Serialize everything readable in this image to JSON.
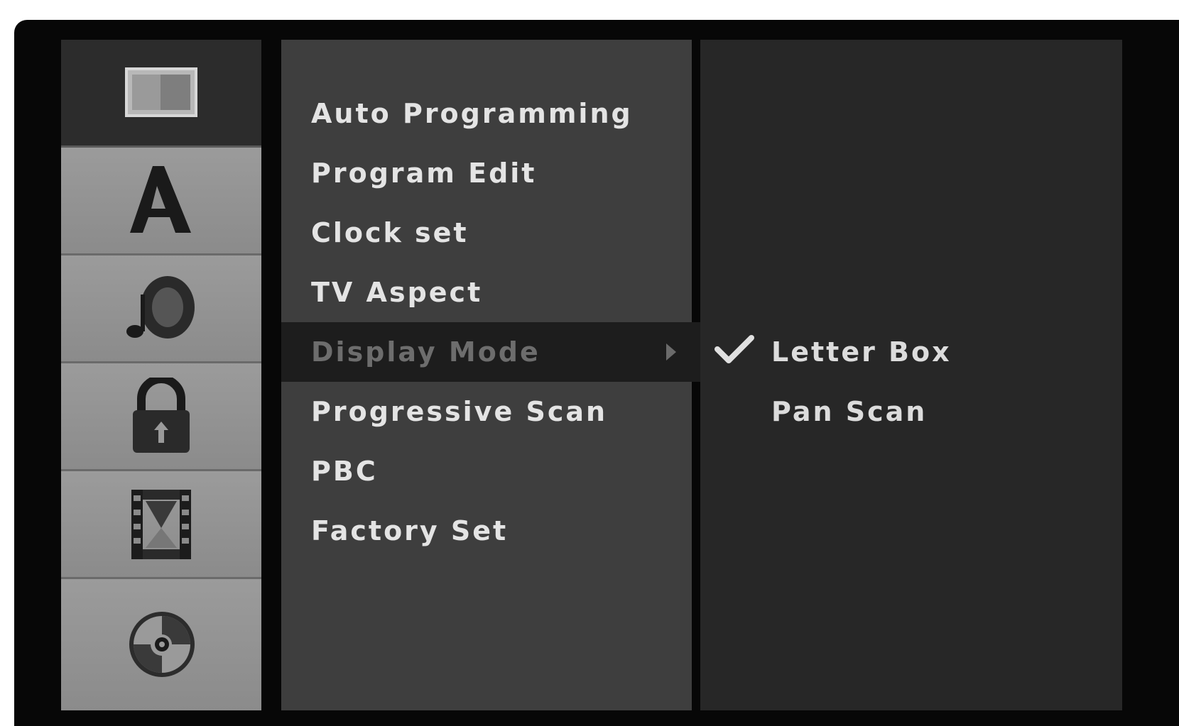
{
  "sidebar": {
    "icons": [
      {
        "name": "tv-icon",
        "active": true
      },
      {
        "name": "language-icon",
        "active": false
      },
      {
        "name": "audio-icon",
        "active": false
      },
      {
        "name": "lock-icon",
        "active": false
      },
      {
        "name": "recording-icon",
        "active": false
      },
      {
        "name": "disc-icon",
        "active": false
      }
    ]
  },
  "menu": {
    "items": [
      {
        "label": "Auto Programming"
      },
      {
        "label": "Program Edit"
      },
      {
        "label": "Clock set"
      },
      {
        "label": "TV Aspect"
      },
      {
        "label": "Display Mode",
        "selected": true
      },
      {
        "label": "Progressive Scan"
      },
      {
        "label": "PBC"
      },
      {
        "label": "Factory Set"
      }
    ]
  },
  "options": {
    "items": [
      {
        "label": "Letter Box",
        "checked": true
      },
      {
        "label": "Pan Scan",
        "checked": false
      }
    ]
  },
  "colors": {
    "frame": "#070707",
    "icon_column": "#8a8a8a",
    "menu_panel": "#3e3e3e",
    "options_panel": "#272727",
    "selected_row": "#1d1d1d",
    "text": "#e4e4e4"
  }
}
